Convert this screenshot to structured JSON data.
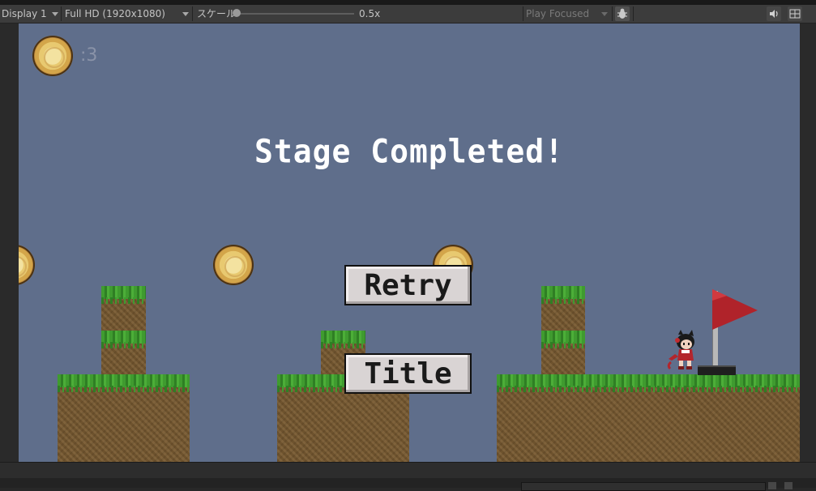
{
  "editor": {
    "display": "Display 1",
    "resolution": "Full HD (1920x1080)",
    "scale_label": "スケール",
    "scale_value": "0.5x",
    "play_mode": "Play Focused"
  },
  "game": {
    "coin_count": ":3",
    "stage_message": "Stage Completed!",
    "retry_button": "Retry",
    "title_button": "Title"
  },
  "colors": {
    "sky": "#5f6e8b",
    "grass": "#3c9430",
    "dirt": "#7a5c33",
    "flag": "#b0232a",
    "button_face": "#d9d4d4"
  },
  "icons": {
    "bug": "bug-icon",
    "speaker": "speaker-icon",
    "grid": "grid-icon"
  }
}
